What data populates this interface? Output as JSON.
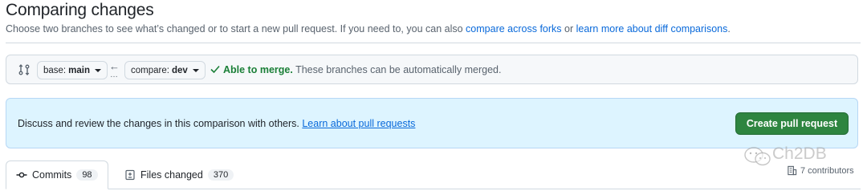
{
  "header": {
    "title": "Comparing changes",
    "subtitle_before": "Choose two branches to see what’s changed or to start a new pull request. If you need to, you can also ",
    "compare_forks_link": "compare across forks",
    "subtitle_middle": " or ",
    "diff_link": "learn more about diff comparisons",
    "subtitle_after": "."
  },
  "range": {
    "base_key": "base:",
    "base_branch": "main",
    "arrow": "←",
    "dots": "…",
    "compare_key": "compare:",
    "compare_branch": "dev",
    "merge_ok": "Able to merge.",
    "merge_message": "These branches can be automatically merged."
  },
  "banner": {
    "text": "Discuss and review the changes in this comparison with others. ",
    "link": "Learn about pull requests",
    "button": "Create pull request"
  },
  "tabs": [
    {
      "label": "Commits",
      "count": "98",
      "icon": "git-commit-icon",
      "selected": true
    },
    {
      "label": "Files changed",
      "count": "370",
      "icon": "file-diff-icon",
      "selected": false
    }
  ],
  "contributors": "7 contributors",
  "watermark": "Ch2DB",
  "colors": {
    "accent_link": "#0969da",
    "success": "#1a7f37",
    "primary_button": "#2e8540",
    "banner_bg": "#ddf4ff"
  }
}
